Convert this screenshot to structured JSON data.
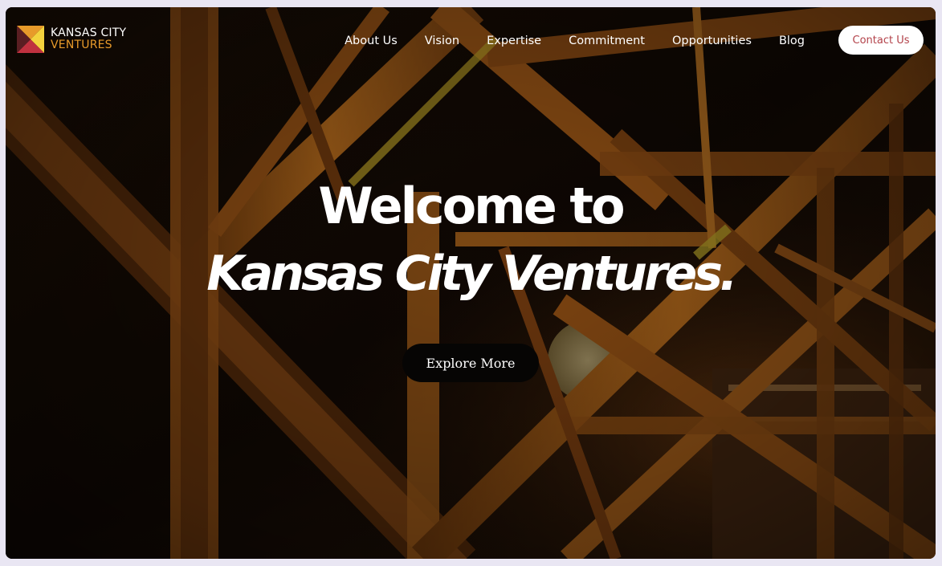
{
  "header": {
    "logo": {
      "line1": "KANSAS CITY",
      "line2": "VENTURES"
    },
    "nav": [
      {
        "label": "About Us"
      },
      {
        "label": "Vision"
      },
      {
        "label": "Expertise"
      },
      {
        "label": "Commitment"
      },
      {
        "label": "Opportunities"
      },
      {
        "label": "Blog"
      }
    ],
    "contact_label": "Contact Us"
  },
  "hero": {
    "title": "Welcome to",
    "subtitle": "Kansas City Ventures.",
    "cta_label": "Explore More"
  },
  "colors": {
    "accent": "#e79a2a",
    "contact_text": "#b3424a",
    "steel": "#c4731c"
  }
}
